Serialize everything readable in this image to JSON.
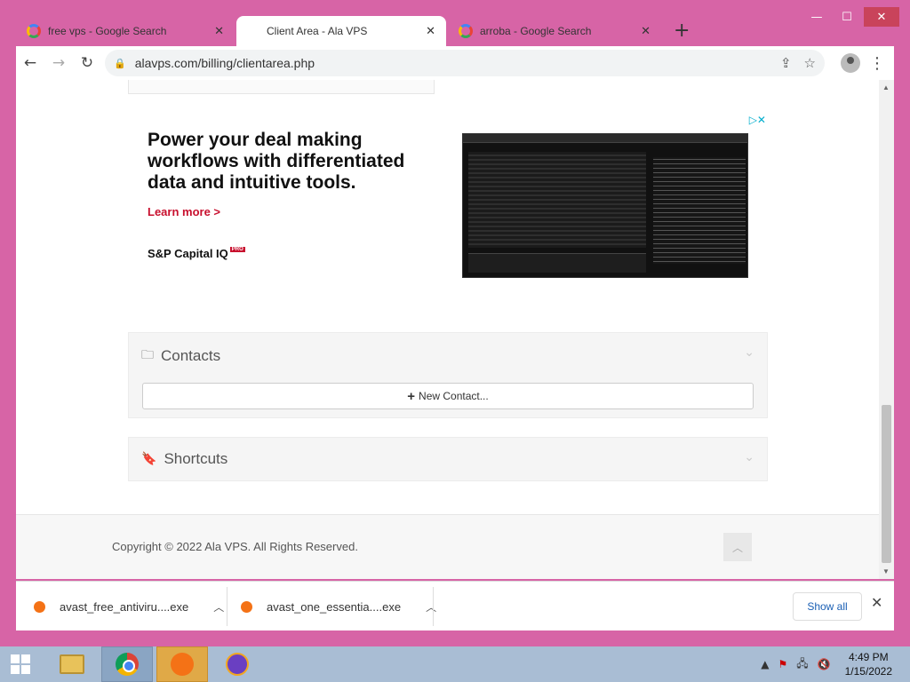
{
  "window": {
    "minimize": "—",
    "maximize": "☐",
    "close": "✕"
  },
  "tabs": [
    {
      "title": "free vps - Google Search",
      "active": false
    },
    {
      "title": "Client Area - Ala VPS",
      "active": true
    },
    {
      "title": "arroba - Google Search",
      "active": false
    }
  ],
  "new_tab_label": "+",
  "toolbar": {
    "back": "←",
    "forward": "→",
    "reload": "↻",
    "url": "alavps.com/billing/clientarea.php",
    "lock": "🔒",
    "share": "⇪",
    "bookmark": "☆",
    "menu": "⋮"
  },
  "ad": {
    "headline": "Power your deal making workflows with differentiated data and intuitive tools.",
    "learn_more": "Learn more >",
    "brand": "S&P Capital IQ",
    "brand_badge": "PRO",
    "choices_icon": "▷✕"
  },
  "contacts": {
    "title": "Contacts",
    "new_contact_label": "New Contact...",
    "icon": "folder-icon"
  },
  "shortcuts": {
    "title": "Shortcuts",
    "icon": "bookmark-icon"
  },
  "footer": {
    "copyright": "Copyright © 2022 Ala VPS. All Rights Reserved.",
    "to_top": "︿"
  },
  "downloads": {
    "items": [
      {
        "name": "avast_free_antiviru....exe"
      },
      {
        "name": "avast_one_essentia....exe"
      }
    ],
    "show_all": "Show all",
    "close": "✕"
  },
  "taskbar": {
    "time": "4:49 PM",
    "date": "1/15/2022",
    "tray_arrow": "▲"
  }
}
